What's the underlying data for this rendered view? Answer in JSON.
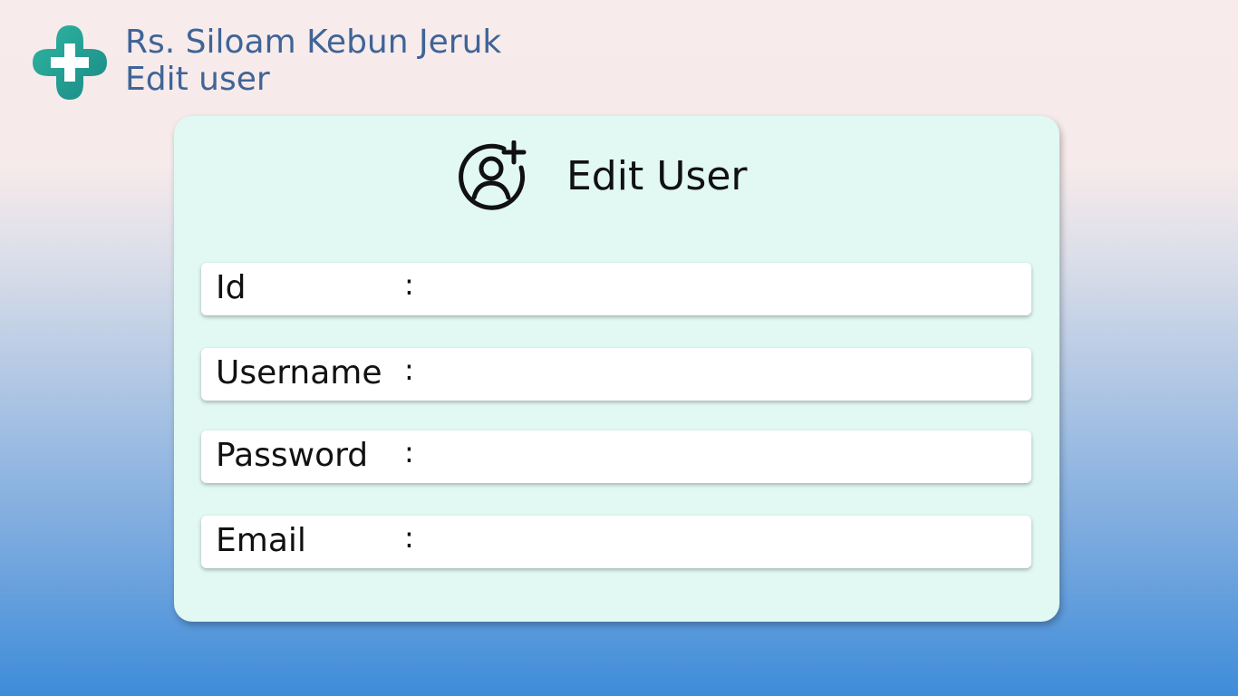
{
  "header": {
    "hospital_name": "Rs. Siloam Kebun Jeruk",
    "page_name": "Edit user",
    "logo_icon": "medical-cross-icon",
    "text_color": "#3f6497"
  },
  "card": {
    "title": "Edit User",
    "title_icon": "add-user-icon",
    "background": "#e1f8f3"
  },
  "form": {
    "fields": [
      {
        "label": "Id",
        "separator": ":",
        "value": "",
        "placeholder": ""
      },
      {
        "label": "Username",
        "separator": ":",
        "value": "",
        "placeholder": ""
      },
      {
        "label": "Password",
        "separator": ":",
        "value": "",
        "placeholder": ""
      },
      {
        "label": "Email",
        "separator": ":",
        "value": "",
        "placeholder": ""
      }
    ]
  }
}
